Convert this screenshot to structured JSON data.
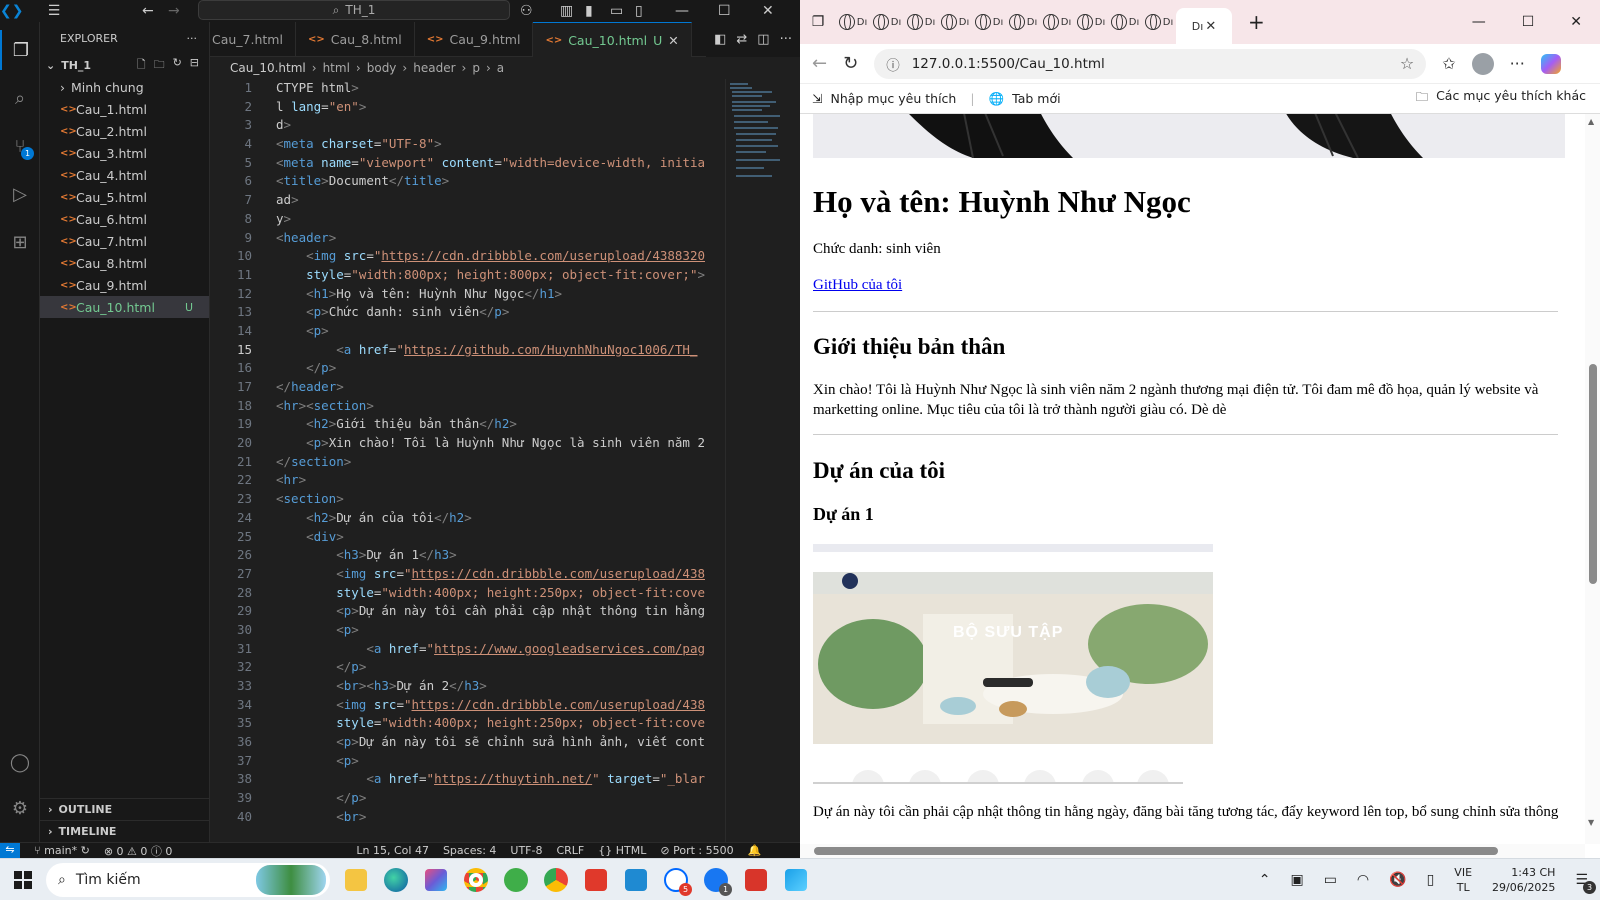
{
  "vscode": {
    "title_search": "TH_1",
    "explorer_label": "EXPLORER",
    "project": "TH_1",
    "files": [
      {
        "name": "Minh chung",
        "type": "folder"
      },
      {
        "name": "Cau_1.html"
      },
      {
        "name": "Cau_2.html"
      },
      {
        "name": "Cau_3.html"
      },
      {
        "name": "Cau_4.html"
      },
      {
        "name": "Cau_5.html"
      },
      {
        "name": "Cau_6.html"
      },
      {
        "name": "Cau_7.html"
      },
      {
        "name": "Cau_8.html"
      },
      {
        "name": "Cau_9.html"
      },
      {
        "name": "Cau_10.html",
        "status": "U"
      }
    ],
    "outline_label": "OUTLINE",
    "timeline_label": "TIMELINE",
    "tabs": [
      "Cau_7.html",
      "Cau_8.html",
      "Cau_9.html",
      "Cau_10.html"
    ],
    "active_tab_status": "U",
    "breadcrumb": [
      "Cau_10.html",
      "html",
      "body",
      "header",
      "p",
      "a"
    ],
    "source_control_badge": "1",
    "code_lines": [
      "CTYPE html>",
      "l lang=\"en\">",
      "d>",
      "<meta charset=\"UTF-8\">",
      "<meta name=\"viewport\" content=\"width=device-width, initia",
      "<title>Document</title>",
      "ad>",
      "y>",
      "<header>",
      "    <img src=\"https://cdn.dribbble.com/userupload/4388320",
      "    style=\"width:800px; height:800px; object-fit:cover;\">",
      "    <h1>Họ và tên: Huỳnh Như Ngọc</h1>",
      "    <p>Chức danh: sinh viên</p>",
      "    <p>",
      "        <a href=\"https://github.com/HuynhNhuNgoc1006/TH_",
      "    </p>",
      "</header>",
      "<hr><section>",
      "    <h2>Giới thiệu bản thân</h2>",
      "    <p>Xin chào! Tôi là Huỳnh Như Ngọc là sinh viên năm 2",
      "</section>",
      "<hr>",
      "<section>",
      "    <h2>Dự án của tôi</h2>",
      "    <div>",
      "        <h3>Dự án 1</h3>",
      "        <img src=\"https://cdn.dribbble.com/userupload/438",
      "        style=\"width:400px; height:250px; object-fit:cove",
      "        <p>Dự án này tôi cần phải cập nhật thông tin hằng",
      "        <p>",
      "            <a href=\"https://www.googleadservices.com/pag",
      "        </p>",
      "        <br><h3>Dự án 2</h3>",
      "        <img src=\"https://cdn.dribbble.com/userupload/438",
      "        style=\"width:400px; height:250px; object-fit:cove",
      "        <p>Dự án này tôi sẽ chỉnh sửa hình ảnh, viết cont",
      "        <p>",
      "            <a href=\"https://thuytinh.net/\" target=\"_blar",
      "        </p>",
      "        <br>"
    ],
    "current_line": 15,
    "status": {
      "branch": "main*",
      "errors": "0",
      "warnings": "0",
      "infos": "0",
      "position": "Ln 15, Col 47",
      "spaces": "Spaces: 4",
      "encoding": "UTF-8",
      "eol": "CRLF",
      "language": "HTML",
      "port": "Port : 5500"
    }
  },
  "browser": {
    "tab_short": "Dı",
    "active_tab_short": "Dı",
    "url": "127.0.0.1:5500/Cau_10.html",
    "fav_bar": {
      "import": "Nhập mục yêu thích",
      "new_tab": "Tab mới",
      "other": "Các mục yêu thích khác"
    },
    "page": {
      "h1": "Họ và tên: Huỳnh Như Ngọc",
      "title_line": "Chức danh: sinh viên",
      "github_link": "GitHub của tôi",
      "about_h2": "Giới thiệu bản thân",
      "about_text": "Xin chào! Tôi là Huỳnh Như Ngọc là sinh viên năm 2 ngành thương mại điện tử. Tôi đam mê đồ họa, quản lý website và marketting online. Mục tiêu của tôi là trở thành người giàu có. Dè dè",
      "projects_h2": "Dự án của tôi",
      "project1_h3": "Dự án 1",
      "project1_image_text": "BỘ SƯU TẬP",
      "project1_desc": "Dự án này tôi cần phải cập nhật thông tin hằng ngày, đăng bài tăng tương tác, đẩy keyword lên top, bổ sung chỉnh sửa thông"
    }
  },
  "taskbar": {
    "search_placeholder": "Tìm kiếm",
    "lang_top": "VIE",
    "lang_bottom": "TL",
    "time": "1:43 CH",
    "date": "29/06/2025",
    "notification_badge": "3",
    "app_badge_1": "5",
    "app_badge_2": "1"
  },
  "colors": {
    "vscode_bg": "#1f1f1f",
    "accent": "#0078d4",
    "untracked": "#73c991",
    "browser_tabbar": "#f7e6e9",
    "link": "#0000ee"
  }
}
